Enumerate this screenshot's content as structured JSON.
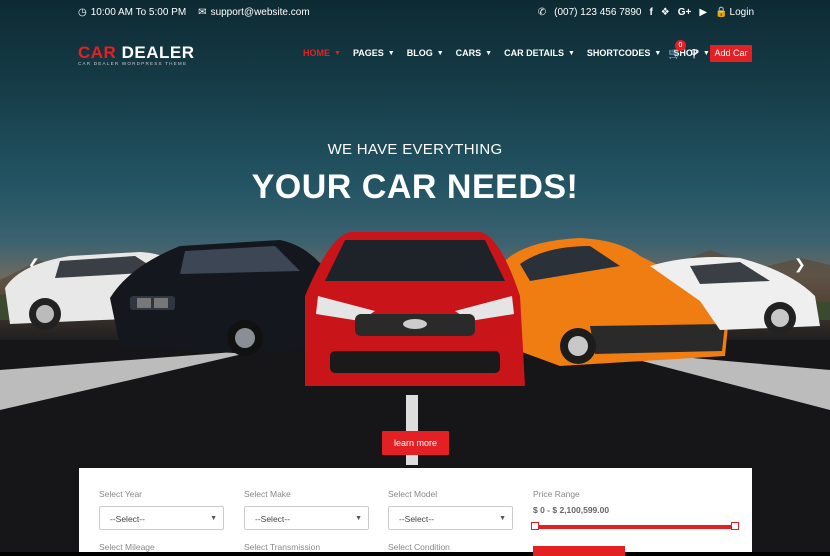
{
  "topbar": {
    "hours": "10:00 AM To 5:00 PM",
    "email": "support@website.com",
    "phone": "(007) 123 456 7890",
    "social": [
      "f",
      "twitter",
      "G+",
      "youtube"
    ],
    "login": "Login"
  },
  "brand": {
    "logo_part1": "CAR",
    "logo_part2": "DEALER",
    "tagline": "CAR DEALER WORDPRESS THEME"
  },
  "nav": {
    "items": [
      {
        "label": "HOME",
        "active": true
      },
      {
        "label": "PAGES"
      },
      {
        "label": "BLOG"
      },
      {
        "label": "CARS"
      },
      {
        "label": "CAR DETAILS"
      },
      {
        "label": "SHORTCODES"
      },
      {
        "label": "SHOP"
      }
    ],
    "cart_count": "0",
    "add_car": "Add Car"
  },
  "hero": {
    "subtitle": "WE HAVE EVERYTHING",
    "title": "YOUR CAR NEEDS!",
    "cta": "learn more"
  },
  "search_panel": {
    "fields": [
      {
        "label": "Select Year",
        "value": "--Select--"
      },
      {
        "label": "Select Make",
        "value": "--Select--"
      },
      {
        "label": "Select Model",
        "value": "--Select--"
      }
    ],
    "price_label": "Price Range",
    "price_value": "$ 0 - $ 2,100,599.00",
    "row2": [
      "Select Mileage",
      "Select Transmission",
      "Select Condition"
    ]
  },
  "colors": {
    "accent": "#e32124"
  }
}
